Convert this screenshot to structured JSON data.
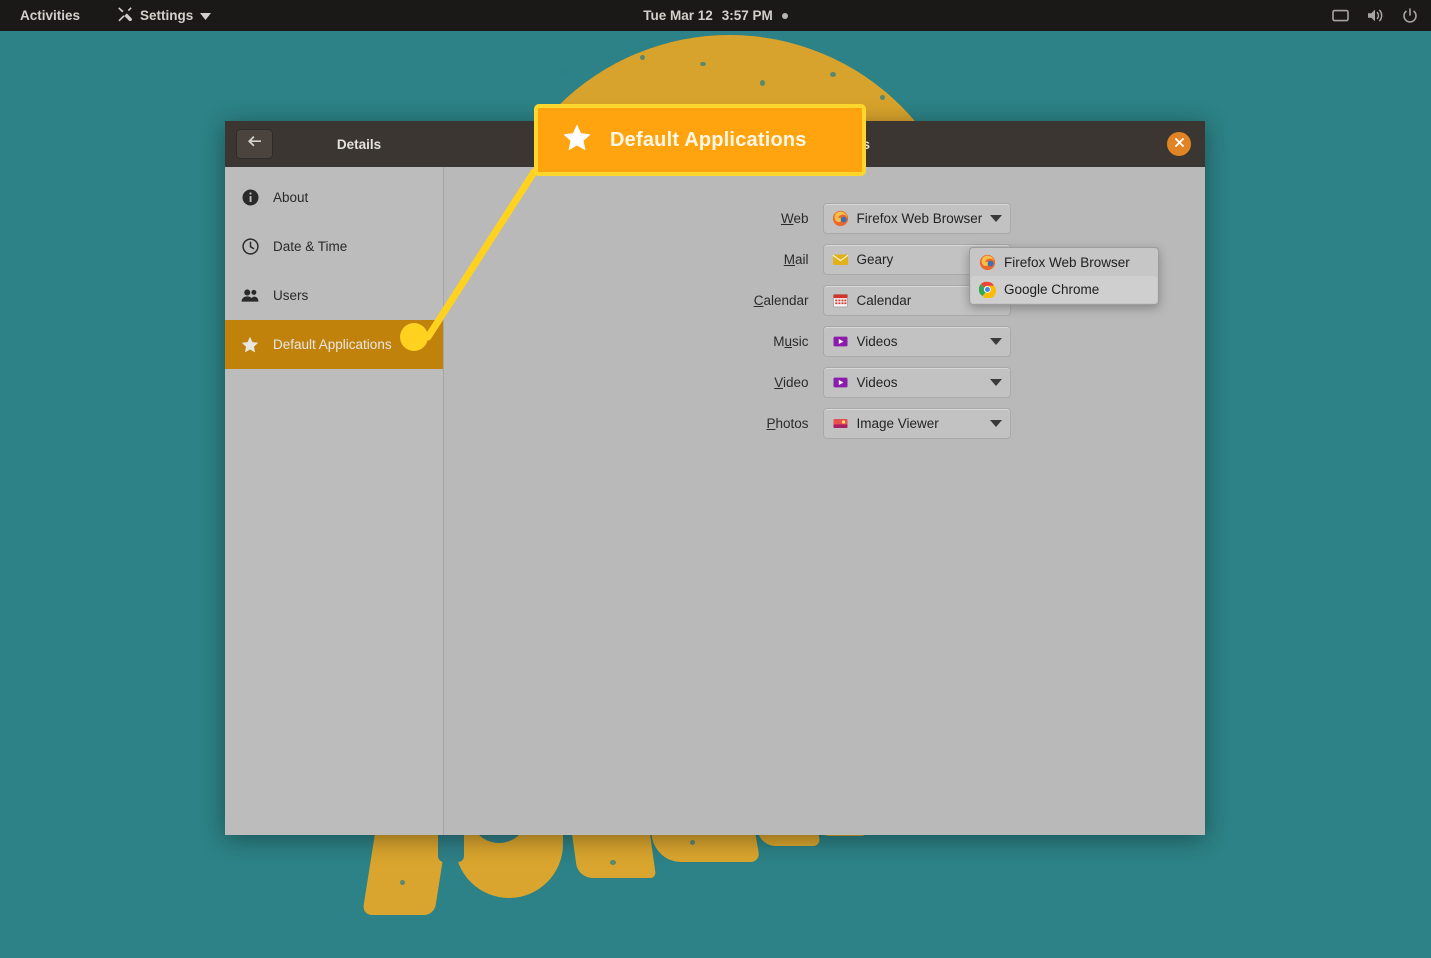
{
  "topbar": {
    "activities": "Activities",
    "app_menu": {
      "label": "Settings",
      "icon": "tools-icon",
      "arrow": "chevron-down-icon"
    },
    "clock": {
      "date": "Tue Mar 12",
      "time": "3:57 PM",
      "indicator_icon": "recording-dot-icon"
    },
    "status_icons": [
      "display-icon",
      "volume-icon",
      "power-icon"
    ]
  },
  "window": {
    "sidebar_title": "Details",
    "main_title": "Default Applications",
    "back_icon": "back-arrow-icon",
    "close_icon": "close-icon"
  },
  "sidebar": {
    "items": [
      {
        "label": "About",
        "icon": "info-icon",
        "selected": false
      },
      {
        "label": "Date & Time",
        "icon": "clock-icon",
        "selected": false
      },
      {
        "label": "Users",
        "icon": "users-icon",
        "selected": false
      },
      {
        "label": "Default Applications",
        "icon": "star-icon",
        "selected": true
      }
    ]
  },
  "settings_rows": [
    {
      "label": "Web",
      "mnemonic": "W",
      "value": "Firefox Web Browser",
      "icon": "firefox-icon",
      "open": true
    },
    {
      "label": "Mail",
      "mnemonic": "M",
      "value": "Geary",
      "icon": "geary-icon",
      "open": false
    },
    {
      "label": "Calendar",
      "mnemonic": "C",
      "value": "Calendar",
      "icon": "calendar-icon",
      "open": false
    },
    {
      "label": "Music",
      "mnemonic": "u",
      "value": "Videos",
      "icon": "videos-icon",
      "open": false
    },
    {
      "label": "Video",
      "mnemonic": "V",
      "value": "Videos",
      "icon": "videos-icon",
      "open": false
    },
    {
      "label": "Photos",
      "mnemonic": "P",
      "value": "Image Viewer",
      "icon": "image-viewer-icon",
      "open": false
    }
  ],
  "dropdown": {
    "open_for": "Web",
    "options": [
      {
        "label": "Firefox Web Browser",
        "icon": "firefox-icon",
        "highlighted": false
      },
      {
        "label": "Google Chrome",
        "icon": "chrome-icon",
        "highlighted": true
      }
    ]
  },
  "callout": {
    "text": "Default Applications",
    "icon": "star-icon",
    "fill_color": "#ffa40f",
    "border_color": "#ffd62b",
    "line_color": "#ffd21f"
  },
  "colors": {
    "desktop_teal": "#2c8286",
    "wallpaper_gold": "#d9a52e",
    "topbar": "#1b1918",
    "titlebar": "#3b3632",
    "window_bg": "#b9b9b9",
    "selected_sidebar": "#c1820c",
    "close_button": "#e08325"
  }
}
